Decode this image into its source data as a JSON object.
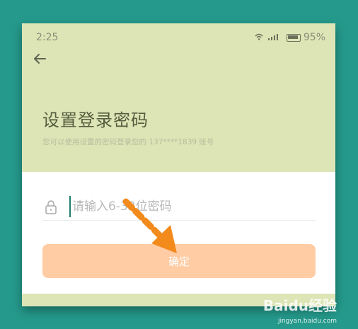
{
  "status_bar": {
    "time": "2:25",
    "icons": "WiFi 4G signal",
    "battery": "95%"
  },
  "header": {
    "back_icon": "arrow-left-icon",
    "title": "设置登录密码",
    "subtitle": "您可以使用设置的密码登录您的 137****1839 账号"
  },
  "form": {
    "password_placeholder": "请输入6-32位密码",
    "lock_icon": "lock-icon",
    "confirm_label": "确定"
  },
  "watermark": {
    "text": "Baidu经验",
    "sub": "jingyan.baidu.com"
  },
  "colors": {
    "page_bg": "#259a8c",
    "header_bg": "#dde5b6",
    "button_bg": "#ffcca4",
    "annotation_arrow": "#f28a1c"
  }
}
